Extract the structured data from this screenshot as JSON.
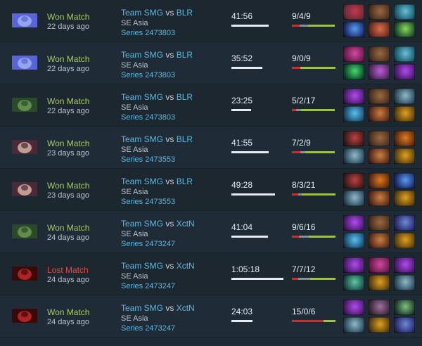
{
  "matches": [
    {
      "result": "Won Match",
      "status": "won",
      "ago": "22 days ago",
      "team1": "Team SMG",
      "vs": "vs",
      "team2": "BLR",
      "region": "SE Asia",
      "series": "Series 2473803",
      "duration": "41:56",
      "duration_fraction": 0.72,
      "kda": "9/4/9",
      "kda_parts": [
        0.18,
        0.2,
        0.62
      ],
      "hero_icon": "spirit-hero-icon",
      "hero_colors": [
        "#5a64d8",
        "#9fb0f0"
      ],
      "items": [
        [
          "dagger-item-icon",
          "#6a2a3a",
          "#c43a4a"
        ],
        [
          "boots-item-icon",
          "#4a3020",
          "#9a6a40"
        ],
        [
          "axe-item-icon",
          "#1a5a6a",
          "#6ac0d8"
        ],
        [
          "orb-item-icon",
          "#1a2a6a",
          "#5a9af0"
        ],
        [
          "hammer-item-icon",
          "#6a2a20",
          "#d87048"
        ],
        [
          "sword-item-icon",
          "#1a4a2a",
          "#8ad85a"
        ]
      ]
    },
    {
      "result": "Won Match",
      "status": "won",
      "ago": "22 days ago",
      "team1": "Team SMG",
      "vs": "vs",
      "team2": "BLR",
      "region": "SE Asia",
      "series": "Series 2473803",
      "duration": "35:52",
      "duration_fraction": 0.6,
      "kda": "9/0/9",
      "kda_parts": [
        0.2,
        0.0,
        0.8
      ],
      "hero_icon": "spirit-hero-icon",
      "hero_colors": [
        "#5a64d8",
        "#9fb0f0"
      ],
      "items": [
        [
          "gem-item-icon",
          "#6a1a4a",
          "#d04aa0"
        ],
        [
          "boots-item-icon",
          "#4a3020",
          "#9a6a40"
        ],
        [
          "axe-item-icon",
          "#1a5a6a",
          "#6ac0d8"
        ],
        [
          "emerald-item-icon",
          "#0a4a2a",
          "#4ad870"
        ],
        [
          "dagger-item-icon",
          "#4a2a5a",
          "#c05ad8"
        ],
        [
          "cross-item-icon",
          "#4a1a6a",
          "#b04af0"
        ]
      ]
    },
    {
      "result": "Won Match",
      "status": "won",
      "ago": "22 days ago",
      "team1": "Team SMG",
      "vs": "vs",
      "team2": "BLR",
      "region": "SE Asia",
      "series": "Series 2473803",
      "duration": "23:25",
      "duration_fraction": 0.38,
      "kda": "5/2/17",
      "kda_parts": [
        0.1,
        0.12,
        0.78
      ],
      "hero_icon": "tree-hero-icon",
      "hero_colors": [
        "#2a4a2a",
        "#6a9a50"
      ],
      "items": [
        [
          "cross-item-icon",
          "#4a1a6a",
          "#b04af0"
        ],
        [
          "boots-item-icon",
          "#4a3020",
          "#9a6a40"
        ],
        [
          "helm-item-icon",
          "#2a4a5a",
          "#90b8c8"
        ],
        [
          "crystal-item-icon",
          "#1a4a6a",
          "#5ac0f0"
        ],
        [
          "drum-item-icon",
          "#5a2a1a",
          "#c88040"
        ],
        [
          "claw-item-icon",
          "#5a4010",
          "#e0a020"
        ]
      ]
    },
    {
      "result": "Won Match",
      "status": "won",
      "ago": "23 days ago",
      "team1": "Team SMG",
      "vs": "vs",
      "team2": "BLR",
      "region": "SE Asia",
      "series": "Series 2473553",
      "duration": "41:55",
      "duration_fraction": 0.72,
      "kda": "7/2/9",
      "kda_parts": [
        0.2,
        0.12,
        0.68
      ],
      "hero_icon": "mage-hero-icon",
      "hero_colors": [
        "#4a2a3a",
        "#d8b0a0"
      ],
      "items": [
        [
          "crab-item-icon",
          "#3a1a1a",
          "#c04040"
        ],
        [
          "boots-item-icon",
          "#4a3020",
          "#9a6a40"
        ],
        [
          "fire-item-icon",
          "#5a2a10",
          "#e07a20"
        ],
        [
          "helm-item-icon",
          "#2a4a5a",
          "#90b8c8"
        ],
        [
          "drum-item-icon",
          "#5a2a1a",
          "#c88040"
        ],
        [
          "claw-item-icon",
          "#5a4010",
          "#e0a020"
        ]
      ]
    },
    {
      "result": "Won Match",
      "status": "won",
      "ago": "23 days ago",
      "team1": "Team SMG",
      "vs": "vs",
      "team2": "BLR",
      "region": "SE Asia",
      "series": "Series 2473553",
      "duration": "49:28",
      "duration_fraction": 0.84,
      "kda": "8/3/21",
      "kda_parts": [
        0.14,
        0.08,
        0.78
      ],
      "hero_icon": "mage-hero-icon",
      "hero_colors": [
        "#4a2a3a",
        "#d8b0a0"
      ],
      "items": [
        [
          "crab-item-icon",
          "#3a1a1a",
          "#c04040"
        ],
        [
          "fire-item-icon",
          "#5a2a10",
          "#e07a20"
        ],
        [
          "orb-item-icon",
          "#1a2a6a",
          "#5a9af0"
        ],
        [
          "helm-item-icon",
          "#2a4a5a",
          "#90b8c8"
        ],
        [
          "drum-item-icon",
          "#5a2a1a",
          "#c88040"
        ],
        [
          "claw-item-icon",
          "#5a4010",
          "#e0a020"
        ]
      ]
    },
    {
      "result": "Won Match",
      "status": "won",
      "ago": "24 days ago",
      "team1": "Team SMG",
      "vs": "vs",
      "team2": "XctN",
      "region": "SE Asia",
      "series": "Series 2473247",
      "duration": "41:04",
      "duration_fraction": 0.7,
      "kda": "9/6/16",
      "kda_parts": [
        0.16,
        0.22,
        0.62
      ],
      "hero_icon": "tree-hero-icon",
      "hero_colors": [
        "#2a4a2a",
        "#6a9a50"
      ],
      "items": [
        [
          "cross-item-icon",
          "#4a1a6a",
          "#b04af0"
        ],
        [
          "boots-item-icon",
          "#4a3020",
          "#9a6a40"
        ],
        [
          "staff-item-icon",
          "#2a2a6a",
          "#6a8ad8"
        ],
        [
          "crystal-item-icon",
          "#1a4a6a",
          "#5ac0f0"
        ],
        [
          "drum-item-icon",
          "#5a2a1a",
          "#c88040"
        ],
        [
          "claw-item-icon",
          "#5a4010",
          "#e0a020"
        ]
      ]
    },
    {
      "result": "Lost Match",
      "status": "lost",
      "ago": "24 days ago",
      "team1": "Team SMG",
      "vs": "vs",
      "team2": "XctN",
      "region": "SE Asia",
      "series": "Series 2473247",
      "duration": "1:05:18",
      "duration_fraction": 1.0,
      "kda": "7/7/12",
      "kda_parts": [
        0.14,
        0.28,
        0.58
      ],
      "hero_icon": "demon-hero-icon",
      "hero_colors": [
        "#3a0a0a",
        "#c02a2a"
      ],
      "items": [
        [
          "cross-item-icon",
          "#4a1a6a",
          "#b04af0"
        ],
        [
          "gem-item-icon",
          "#6a1a4a",
          "#d04aa0"
        ],
        [
          "cross-item-icon",
          "#4a1a6a",
          "#b04af0"
        ],
        [
          "wand-item-icon",
          "#1a4a4a",
          "#60c8a0"
        ],
        [
          "claw-item-icon",
          "#5a4010",
          "#e0a020"
        ],
        [
          "helm-item-icon",
          "#2a4a5a",
          "#90b8c8"
        ]
      ]
    },
    {
      "result": "Won Match",
      "status": "won",
      "ago": "24 days ago",
      "team1": "Team SMG",
      "vs": "vs",
      "team2": "XctN",
      "region": "SE Asia",
      "series": "Series 2473247",
      "duration": "24:03",
      "duration_fraction": 0.4,
      "kda": "15/0/6",
      "kda_parts": [
        0.72,
        0.0,
        0.28
      ],
      "hero_icon": "demon-hero-icon",
      "hero_colors": [
        "#3a0a0a",
        "#c02a2a"
      ],
      "items": [
        [
          "cross-item-icon",
          "#4a1a6a",
          "#b04af0"
        ],
        [
          "claw-blade-item-icon",
          "#3a2a3a",
          "#a070a0"
        ],
        [
          "spear-item-icon",
          "#1a3a2a",
          "#80c080"
        ],
        [
          "helm-item-icon",
          "#2a4a5a",
          "#90b8c8"
        ],
        [
          "claw-item-icon",
          "#5a4010",
          "#e0a020"
        ],
        [
          "staff-item-icon",
          "#2a2a6a",
          "#6a8ad8"
        ]
      ]
    }
  ],
  "colors": {
    "won": "#a6cc5c",
    "lost": "#e34a3c",
    "deaths": "#888f96",
    "kills": "#d62a2a",
    "assists": "#9fc43a"
  }
}
